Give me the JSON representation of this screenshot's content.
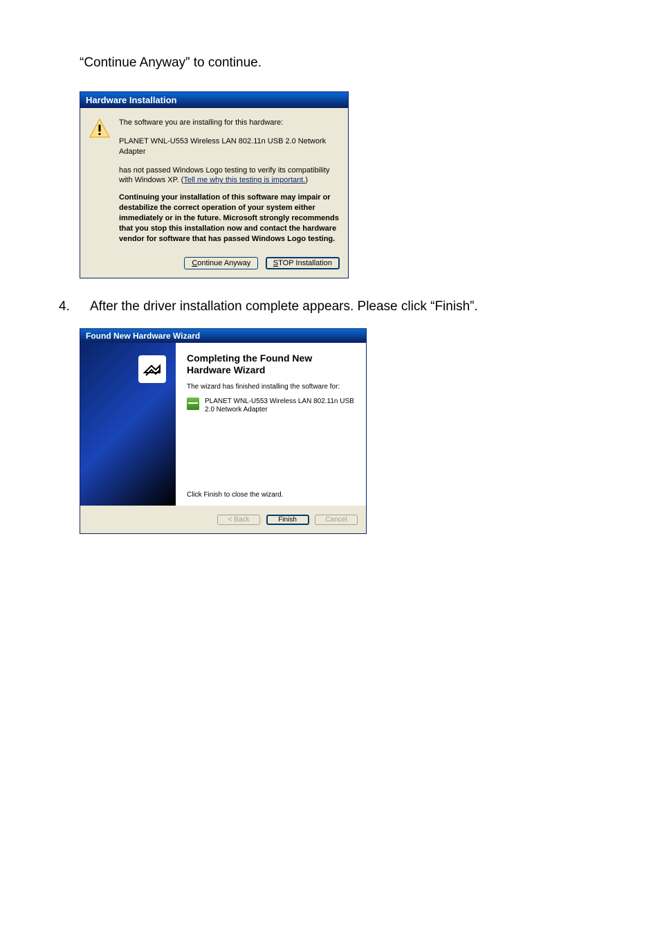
{
  "intro_text": "“Continue Anyway” to continue.",
  "step4": {
    "number": "4.",
    "text": "After the driver installation complete appears.  Please click “Finish”."
  },
  "dialog1": {
    "title": "Hardware Installation",
    "line1": "The software you are installing for this hardware:",
    "device": "PLANET WNL-U553 Wireless LAN 802.11n USB 2.0 Network Adapter",
    "logo_text_pre": "has not passed Windows Logo testing to verify its compatibility with Windows XP. (",
    "link": "Tell me why this testing is important.",
    "logo_text_post": ")",
    "warning": "Continuing your installation of this software may impair or destabilize the correct operation of your system either immediately or in the future. Microsoft strongly recommends that you stop this installation now and contact the hardware vendor for software that has passed Windows Logo testing.",
    "continue_btn": "Continue Anyway",
    "continue_u": "C",
    "continue_rest": "ontinue Anyway",
    "stop_btn_u": "S",
    "stop_btn_rest": "TOP Installation"
  },
  "dialog2": {
    "title": "Found New Hardware Wizard",
    "heading": "Completing the Found New Hardware Wizard",
    "subtext": "The wizard has finished installing the software for:",
    "device": "PLANET WNL-U553 Wireless LAN 802.11n USB 2.0 Network Adapter",
    "close_hint": "Click Finish to close the wizard.",
    "back_lt": "< ",
    "back_u": "B",
    "back_rest": "ack",
    "finish": "Finish",
    "cancel": "Cancel"
  }
}
